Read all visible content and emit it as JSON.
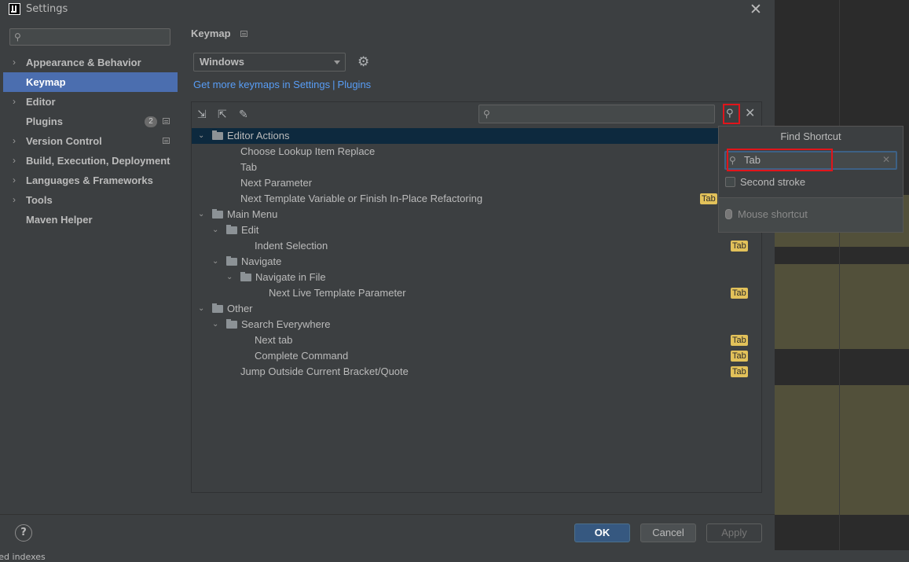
{
  "window": {
    "title": "Settings"
  },
  "sidebar": {
    "search_placeholder": "",
    "items": [
      {
        "label": "Appearance & Behavior",
        "expandable": true
      },
      {
        "label": "Keymap",
        "selected": true
      },
      {
        "label": "Editor",
        "expandable": true
      },
      {
        "label": "Plugins",
        "badge": "2"
      },
      {
        "label": "Version Control",
        "expandable": true
      },
      {
        "label": "Build, Execution, Deployment",
        "expandable": true
      },
      {
        "label": "Languages & Frameworks",
        "expandable": true
      },
      {
        "label": "Tools",
        "expandable": true
      },
      {
        "label": "Maven Helper"
      }
    ]
  },
  "keymap": {
    "title": "Keymap",
    "scheme": "Windows",
    "link_text": "Get more keymaps in Settings",
    "link_sep": "|",
    "link_plugins": "Plugins",
    "filter_placeholder": ""
  },
  "tree": [
    {
      "label": "Editor Actions",
      "level": 0,
      "type": "group",
      "expanded": true,
      "selected": true
    },
    {
      "label": "Choose Lookup Item Replace",
      "level": 1,
      "type": "action"
    },
    {
      "label": "Tab",
      "level": 1,
      "type": "action"
    },
    {
      "label": "Next Parameter",
      "level": 1,
      "type": "action"
    },
    {
      "label": "Next Template Variable or Finish In-Place Refactoring",
      "level": 1,
      "type": "action",
      "shortcut": "Tab"
    },
    {
      "label": "Main Menu",
      "level": 0,
      "type": "group",
      "expanded": true
    },
    {
      "label": "Edit",
      "level": 1,
      "type": "folder",
      "expanded": true
    },
    {
      "label": "Indent Selection",
      "level": 2,
      "type": "action",
      "shortcut": "Tab"
    },
    {
      "label": "Navigate",
      "level": 1,
      "type": "folder",
      "expanded": true
    },
    {
      "label": "Navigate in File",
      "level": 2,
      "type": "folder",
      "expanded": true
    },
    {
      "label": "Next Live Template Parameter",
      "level": 3,
      "type": "action",
      "shortcut": "Tab"
    },
    {
      "label": "Other",
      "level": 0,
      "type": "group",
      "expanded": true
    },
    {
      "label": "Search Everywhere",
      "level": 1,
      "type": "folder",
      "expanded": true
    },
    {
      "label": "Next tab",
      "level": 2,
      "type": "action",
      "shortcut": "Tab"
    },
    {
      "label": "Complete Command",
      "level": 2,
      "type": "action",
      "shortcut": "Tab"
    },
    {
      "label": "Jump Outside Current Bracket/Quote",
      "level": 1,
      "type": "action",
      "shortcut": "Tab"
    }
  ],
  "find_shortcut": {
    "title": "Find Shortcut",
    "value": "Tab",
    "second_stroke": "Second stroke",
    "mouse_shortcut": "Mouse shortcut"
  },
  "footer": {
    "help": "?",
    "ok": "OK",
    "cancel": "Cancel",
    "apply": "Apply"
  },
  "status": {
    "text": "red indexes"
  },
  "colors": {
    "accent": "#4b6eaf",
    "highlight_box": "#e0151b",
    "shortcut_chip": "#e2c15a",
    "link": "#589df6"
  }
}
